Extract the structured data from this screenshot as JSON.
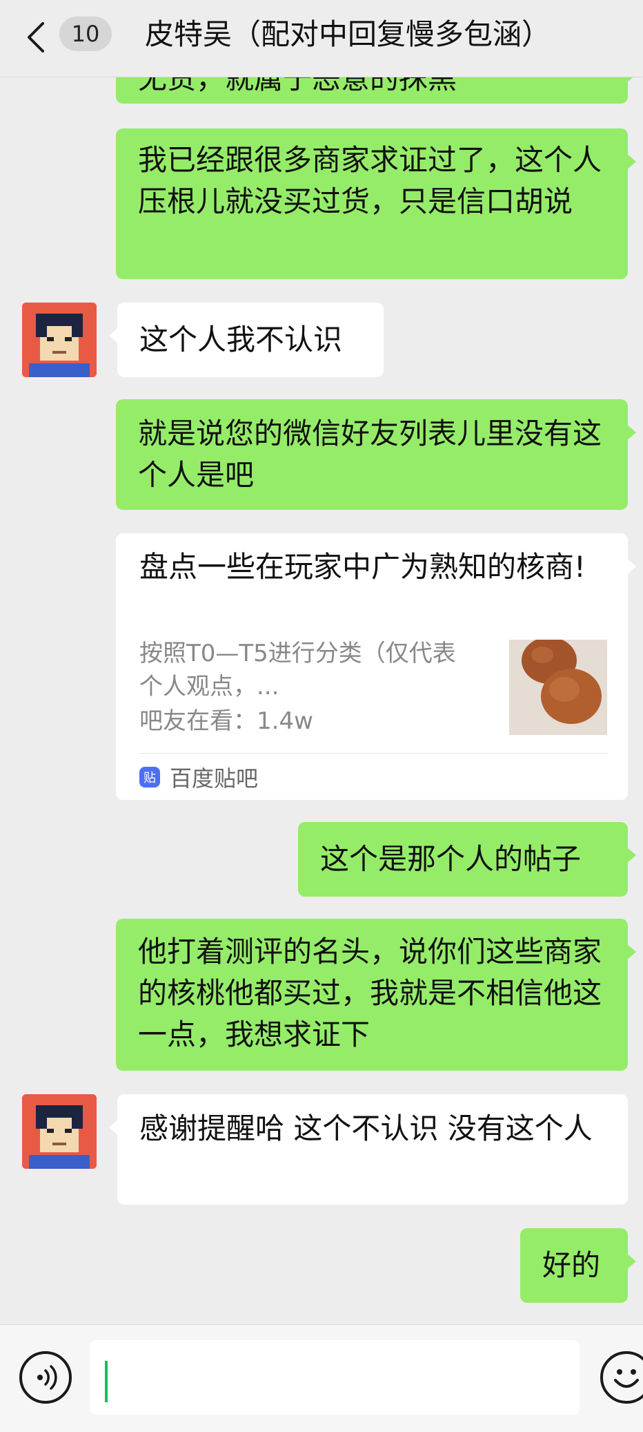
{
  "header": {
    "unread_count": "10",
    "title": "皮特吴（配对中回复慢多包涵）"
  },
  "messages": {
    "m0_partial": "无货，就属于恶意的抹黑",
    "m1": "我已经跟很多商家求证过了，这个人压根儿就没买过货，只是信口胡说",
    "m2": "这个人我不认识",
    "m3": "就是说您的微信好友列表儿里没有这个人是吧",
    "m5": "这个是那个人的帖子",
    "m6": "他打着测评的名头，说你们这些商家的核桃他都买过，我就是不相信他这一点，我想求证下",
    "m7": "感谢提醒哈 这个不认识 没有这个人",
    "m8": "好的"
  },
  "card": {
    "title": "盘点一些在玩家中广为熟知的核商!",
    "description": "按照T0—T5进行分类（仅代表个人观点，...",
    "stats": "吧友在看：1.4w",
    "source_icon_text": "贴",
    "source": "百度贴吧"
  },
  "colors": {
    "sent_bubble": "#95ec69",
    "received_bubble": "#ffffff",
    "background": "#ededed",
    "caret": "#07c160"
  },
  "icons": [
    "back-chevron-icon",
    "voice-icon",
    "emoji-icon"
  ]
}
